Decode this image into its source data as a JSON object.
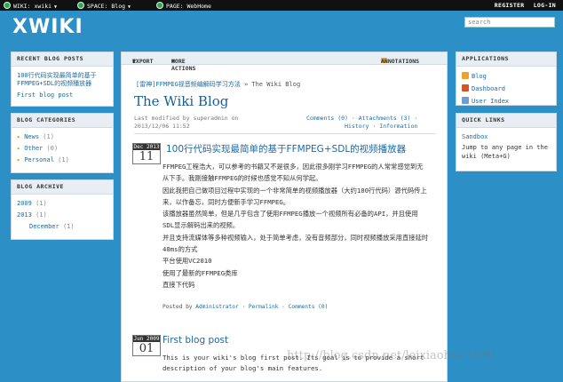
{
  "topbar": {
    "wiki": "WIKI: xwiki",
    "space": "SPACE: Blog",
    "page": "PAGE: WebHome",
    "register": "REGISTER",
    "login": "LOG-IN"
  },
  "header": {
    "logo": "XWIKI",
    "search_placeholder": "search"
  },
  "left": {
    "recent_title": "RECENT BLOG POSTS",
    "recent": [
      "100行代码实现最简单的基于FFMPEG+SDL的视频播放器",
      "First blog post"
    ],
    "categories_title": "BLOG CATEGORIES",
    "categories": [
      {
        "name": "News",
        "count": "(1)"
      },
      {
        "name": "Other",
        "count": "(0)"
      },
      {
        "name": "Personal",
        "count": "(1)"
      }
    ],
    "archive_title": "BLOG ARCHIVE",
    "archive": [
      {
        "label": "2009",
        "count": "(1)"
      },
      {
        "label": "2013",
        "count": "(1)"
      },
      {
        "label": "December",
        "count": "(1)"
      }
    ]
  },
  "main": {
    "export": "EXPORT",
    "more_actions": "MORE ACTIONS",
    "annotations": "ANNOTATIONS",
    "breadcrumb_link": "[雷神]FFMPEG视音频编解码学习方法",
    "breadcrumb_sep": "»",
    "breadcrumb_current": "The Wiki Blog",
    "title": "The Wiki Blog",
    "meta_line1": "Last modified by superadmin on",
    "meta_line2": "2013/12/06 11:52",
    "comments": "Comments (0)",
    "attachments": "Attachments (3)",
    "history": "History",
    "information": "Information",
    "link_dot": "·",
    "post1": {
      "month": "Dec 2013",
      "day": "11",
      "title": "100行代码实现最简单的基于FFMPEG+SDL的视频播放器",
      "paragraphs": [
        "FFMPEG工程浩大，可以参考的书籍又不是很多，因此很多刚学习FFMPEG的人常常感觉到无从下手。我刚接触FFMPEG的时候也感觉不知从何学起。",
        "因此我把自己做项目过程中实现的一个非常简单的视频播放器（大约100行代码）源代码传上来，以作备忘，同时方便新手学习FFMPEG。",
        "该播放器虽然简单，但是几乎包含了使用FFMPEG播放一个视频所有必备的API，并且使用SDL显示解码出来的视频。",
        "并且支持流媒体等多种视频输入，处于简单考虑，没有音频部分，同时视频播放采用直接延时40ms的方式",
        "平台使用VC2010",
        "使用了最新的FFMPEG类库",
        "直接下代码"
      ],
      "posted_by": "Posted by",
      "author": "Administrator",
      "permalink": "Permalink",
      "comments": "Comments (0)",
      "sep": "·"
    },
    "post2": {
      "month": "Jun 2009",
      "day": "01",
      "title": "First blog post",
      "body": "This is your wiki's blog first post. Its goal is to provide a short description of your blog's main features."
    },
    "watermark": "http://blog.csdn.net/leixiaohua1020"
  },
  "right": {
    "apps_title": "APPLICATIONS",
    "apps": [
      "Blog",
      "Dashboard",
      "User Index"
    ],
    "quicklinks_title": "QUICK LINKS",
    "sandbox": "Sandbox",
    "jump": "Jump to any page in the wiki (Meta+G)"
  }
}
